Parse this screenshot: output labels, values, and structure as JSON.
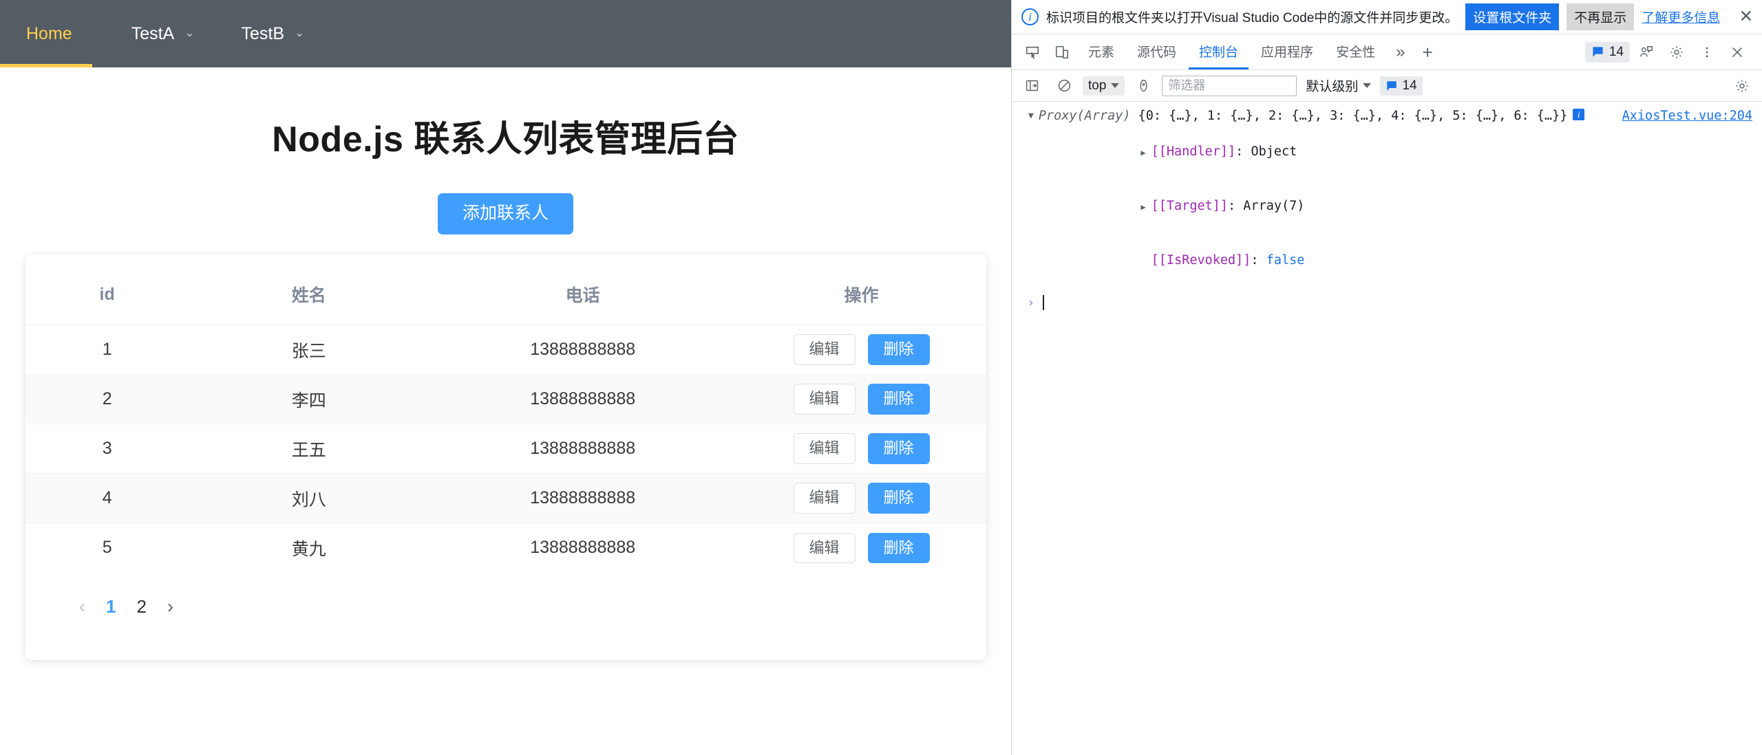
{
  "nav": {
    "items": [
      {
        "label": "Home",
        "active": true,
        "has_caret": false
      },
      {
        "label": "TestA",
        "active": false,
        "has_caret": true
      },
      {
        "label": "TestB",
        "active": false,
        "has_caret": true
      }
    ],
    "active_color": "#ffd04b",
    "background": "#545c64"
  },
  "page": {
    "title": "Node.js 联系人列表管理后台",
    "add_button": "添加联系人",
    "accent_color": "#409eff"
  },
  "table": {
    "headers": {
      "id": "id",
      "name": "姓名",
      "phone": "电话",
      "op": "操作"
    },
    "actions": {
      "edit": "编辑",
      "delete": "删除"
    },
    "rows": [
      {
        "id": "1",
        "name": "张三",
        "phone": "13888888888"
      },
      {
        "id": "2",
        "name": "李四",
        "phone": "13888888888"
      },
      {
        "id": "3",
        "name": "王五",
        "phone": "13888888888"
      },
      {
        "id": "4",
        "name": "刘八",
        "phone": "13888888888"
      },
      {
        "id": "5",
        "name": "黄九",
        "phone": "13888888888"
      }
    ]
  },
  "pagination": {
    "prev": "‹",
    "next": "›",
    "pages": [
      "1",
      "2"
    ],
    "current": "1",
    "active_color": "#409eff"
  },
  "devtools": {
    "banner": {
      "icon": "info-icon",
      "message": "标识项目的根文件夹以打开Visual Studio Code中的源文件并同步更改。",
      "primary_button": "设置根文件夹",
      "secondary_button": "不再显示",
      "link": "了解更多信息",
      "close": "✕"
    },
    "tabs": [
      {
        "label": "元素",
        "active": false
      },
      {
        "label": "源代码",
        "active": false
      },
      {
        "label": "控制台",
        "active": true
      },
      {
        "label": "应用程序",
        "active": false
      },
      {
        "label": "安全性",
        "active": false
      }
    ],
    "tab_overflow": "»",
    "tab_add": "+",
    "message_count": "14",
    "console_bar": {
      "context": "top",
      "filter_placeholder": "筛选器",
      "level": "默认级别",
      "badge_count": "14"
    },
    "console_log": {
      "constructor": "Proxy(Array)",
      "preview": "{0: {…}, 1: {…}, 2: {…}, 3: {…}, 4: {…}, 5: {…}, 6: {…}}",
      "info_badge": "i",
      "source": "AxiosTest.vue:204",
      "props": [
        {
          "name": "[[Handler]]",
          "value": "Object",
          "expandable": true,
          "is_bool": false
        },
        {
          "name": "[[Target]]",
          "value": "Array(7)",
          "expandable": true,
          "is_bool": false
        },
        {
          "name": "[[IsRevoked]]",
          "value": "false",
          "expandable": false,
          "is_bool": true
        }
      ]
    },
    "prompt": {
      "chevron": "›"
    }
  }
}
